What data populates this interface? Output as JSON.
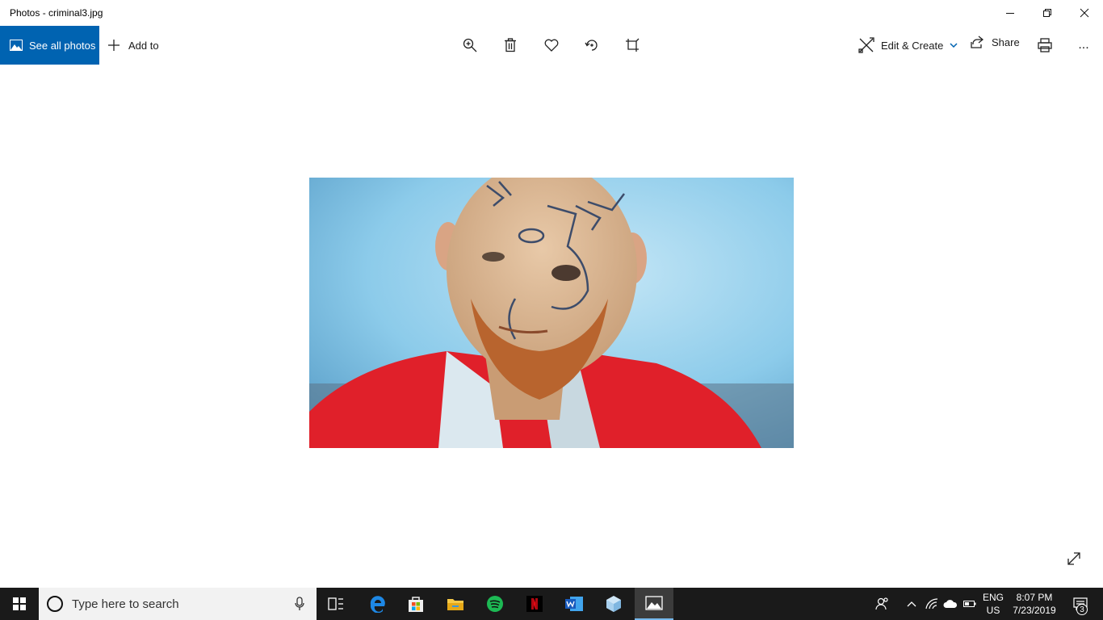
{
  "window": {
    "title": "Photos - criminal3.jpg"
  },
  "toolbar": {
    "see_all_label": "See all photos",
    "add_to_label": "Add to",
    "edit_create_label": "Edit & Create",
    "share_label": "Share",
    "more_label": "..."
  },
  "taskbar": {
    "search_placeholder": "Type here to search",
    "lang_line1": "ENG",
    "lang_line2": "US",
    "time": "8:07 PM",
    "date": "7/23/2019",
    "notification_count": "3"
  },
  "colors": {
    "accent": "#0063b1",
    "taskbar": "#1a1a1a",
    "shirt": "#e0202a"
  }
}
